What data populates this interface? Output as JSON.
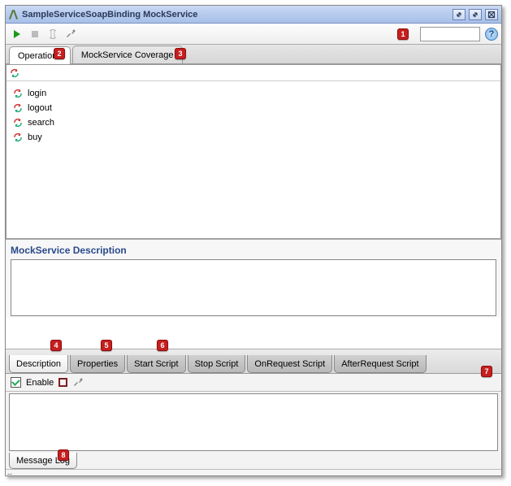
{
  "window": {
    "title": "SampleServiceSoapBinding MockService"
  },
  "toolbar": {
    "run": "run",
    "stop": "stop",
    "cursor": "cursor",
    "tools": "tools"
  },
  "top_tabs": [
    {
      "label": "Operations",
      "active": true
    },
    {
      "label": "MockService Coverage",
      "active": false
    }
  ],
  "operations": [
    {
      "label": "login"
    },
    {
      "label": "logout"
    },
    {
      "label": "search"
    },
    {
      "label": "buy"
    }
  ],
  "description": {
    "title": "MockService Description",
    "value": ""
  },
  "detail_tabs": [
    {
      "label": "Description",
      "active": true
    },
    {
      "label": "Properties",
      "active": false
    },
    {
      "label": "Start Script",
      "active": false
    },
    {
      "label": "Stop Script",
      "active": false
    },
    {
      "label": "OnRequest Script",
      "active": false
    },
    {
      "label": "AfterRequest Script",
      "active": false
    }
  ],
  "log": {
    "enable_label": "Enable",
    "enable_checked": true,
    "tab_label": "Message Log"
  },
  "markers": {
    "m1": "1",
    "m2": "2",
    "m3": "3",
    "m4": "4",
    "m5": "5",
    "m6": "6",
    "m7": "7",
    "m8": "8"
  }
}
